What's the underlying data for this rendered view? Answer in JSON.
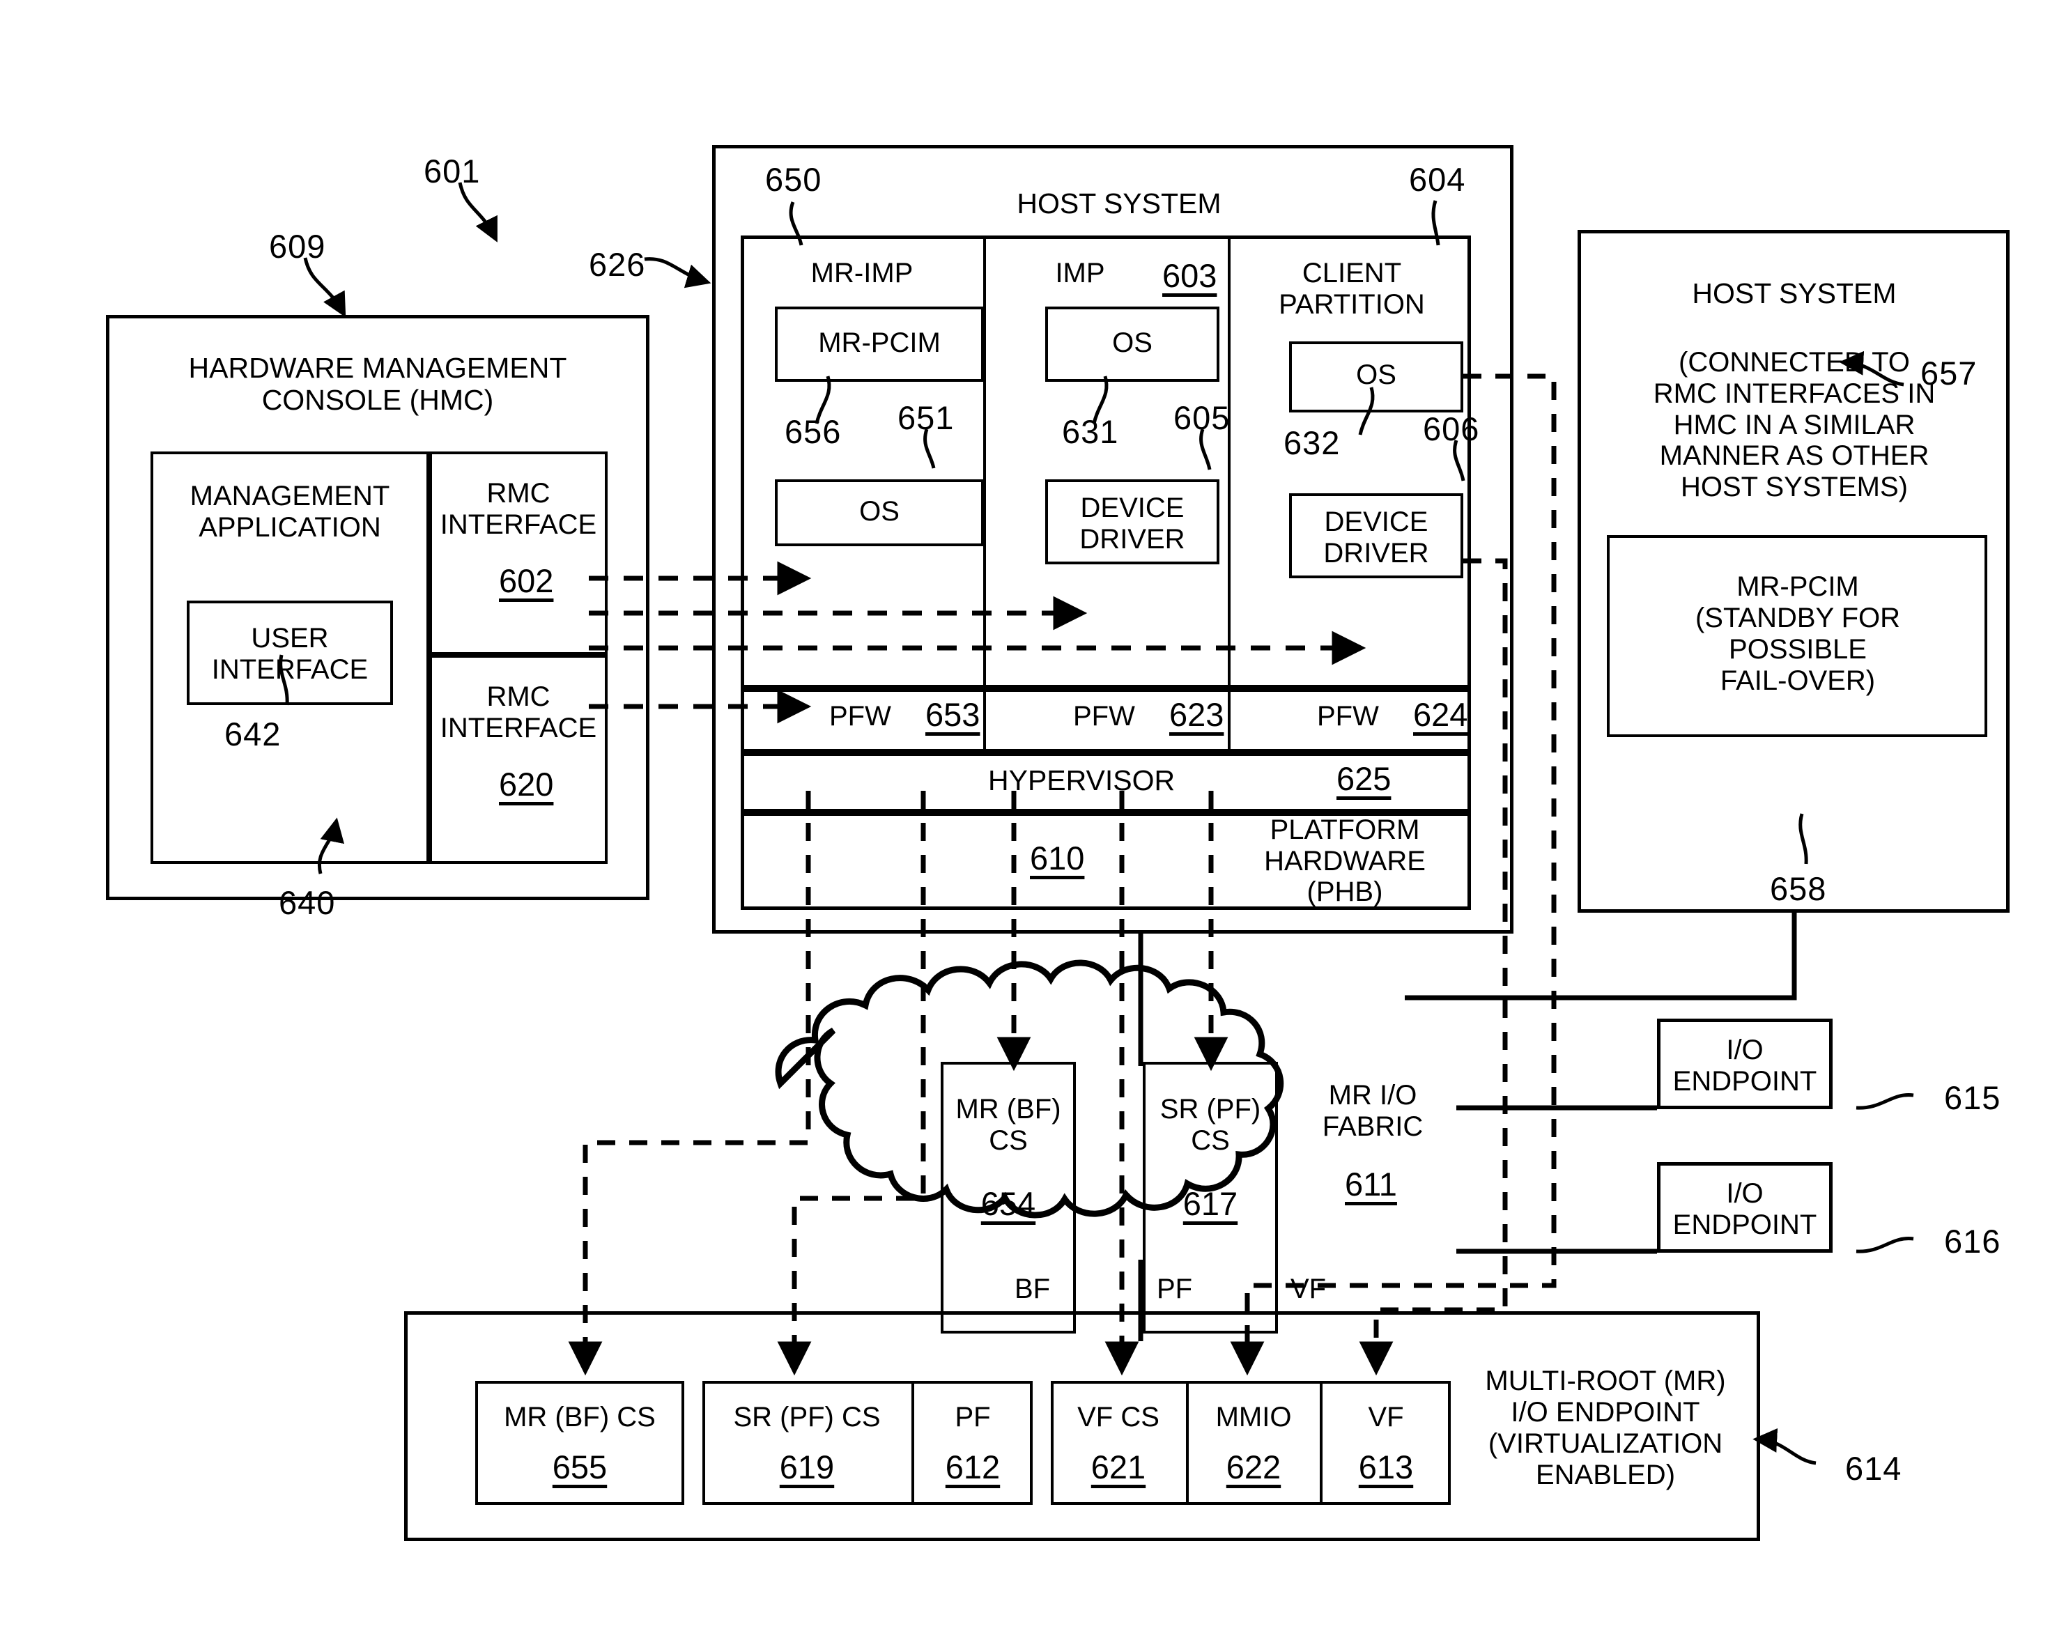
{
  "figure": {
    "ref_601": "601",
    "ref_609": "609",
    "ref_626": "626"
  },
  "hmc": {
    "title": "HARDWARE MANAGEMENT\nCONSOLE (HMC)",
    "management_application": "MANAGEMENT\nAPPLICATION",
    "user_interface": "USER\nINTERFACE",
    "ref_user_interface": "642",
    "ref_management_application": "640",
    "rmc_interface_1": "RMC\nINTERFACE",
    "rmc_interface_1_ref": "602",
    "rmc_interface_2": "RMC\nINTERFACE",
    "rmc_interface_2_ref": "620"
  },
  "host_system": {
    "title": "HOST SYSTEM",
    "partitions": [
      {
        "name": "MR-IMP",
        "ref": "650",
        "child1": "MR-PCIM",
        "child1_ref": "656",
        "child2": "OS",
        "child2_ref": "651",
        "pfw_label": "PFW",
        "pfw_ref": "653"
      },
      {
        "name": "IMP",
        "ref": "603",
        "child1": "OS",
        "child1_ref": "631",
        "child2": "DEVICE\nDRIVER",
        "child2_ref": "605",
        "pfw_label": "PFW",
        "pfw_ref": "623"
      },
      {
        "name": "CLIENT\nPARTITION",
        "ref": "604",
        "child1": "OS",
        "child1_ref": "632",
        "child2": "DEVICE\nDRIVER",
        "child2_ref": "606",
        "pfw_label": "PFW",
        "pfw_ref": "624"
      }
    ],
    "hypervisor_label": "HYPERVISOR",
    "hypervisor_ref": "625",
    "platform_hardware_label": "PLATFORM\nHARDWARE (PHB)",
    "platform_hardware_ref": "610"
  },
  "host_system_standby": {
    "title": "HOST SYSTEM",
    "note": "(CONNECTED TO\nRMC INTERFACES IN\nHMC IN A SIMILAR\nMANNER AS OTHER\nHOST SYSTEMS)",
    "ref": "657",
    "mr_pcim": "MR-PCIM\n(STANDBY FOR\nPOSSIBLE\nFAIL-OVER)",
    "mr_pcim_ref": "658"
  },
  "fabric": {
    "label": "MR I/O\nFABRIC",
    "ref": "611",
    "boxes": [
      {
        "label": "MR (BF)\nCS",
        "ref": "654"
      },
      {
        "label": "SR (PF)\nCS",
        "ref": "617"
      }
    ]
  },
  "io_endpoints": [
    {
      "label": "I/O\nENDPOINT",
      "ref": "615"
    },
    {
      "label": "I/O\nENDPOINT",
      "ref": "616"
    }
  ],
  "mr_endpoint": {
    "title": "MULTI-ROOT (MR)\nI/O ENDPOINT\n(VIRTUALIZATION\nENABLED)",
    "ref": "614",
    "cells": [
      {
        "label": "MR (BF) CS",
        "ref": "655"
      },
      {
        "label": "SR (PF) CS",
        "ref": "619"
      },
      {
        "label": "PF",
        "ref": "612"
      },
      {
        "label": "VF CS",
        "ref": "621"
      },
      {
        "label": "MMIO",
        "ref": "622"
      },
      {
        "label": "VF",
        "ref": "613"
      }
    ],
    "bus_labels": [
      "BF",
      "PF",
      "VF"
    ]
  },
  "colors": {
    "line": "#000000",
    "background": "#ffffff"
  }
}
